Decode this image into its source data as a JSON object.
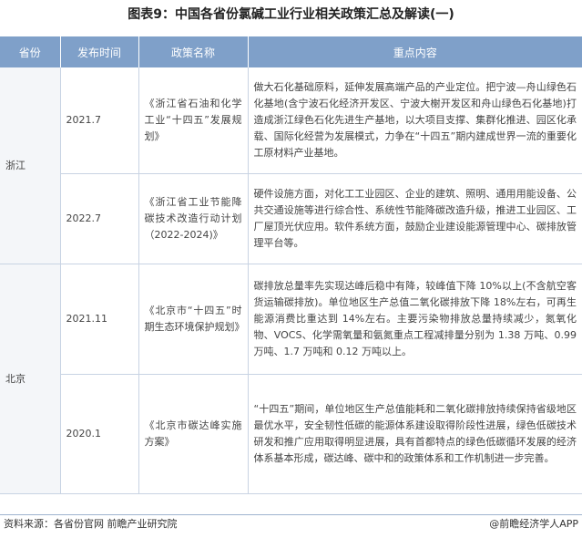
{
  "title": "图表9：中国各省份氯碱工业行业相关政策汇总及解读(一)",
  "headers": [
    "省份",
    "发布时间",
    "政策名称",
    "重点内容"
  ],
  "rows": [
    {
      "province": "浙江",
      "date": "2021.7",
      "name": "《浙江省石油和化学工业“十四五”发展规划》",
      "content": "做大石化基础原料，延伸发展高端产品的产业定位。把宁波—舟山绿色石化基地(含宁波石化经济开发区、宁波大榭开发区和舟山绿色石化基地)打造成浙江绿色石化先进生产基地，以大项目支撑、集群化推进、园区化承载、国际化经营为发展模式，力争在“十四五”期内建成世界一流的重要化工原材料产业基地。"
    },
    {
      "province": "",
      "date": "2022.7",
      "name": "《浙江省工业节能降碳技术改造行动计划（2022-2024)》",
      "content": "硬件设施方面，对化工工业园区、企业的建筑、照明、通用用能设备、公共交通设施等进行综合性、系统性节能降碳改造升级，推进工业园区、工厂屋顶光伏应用。软件系统方面，鼓励企业建设能源管理中心、碳排放管理平台等。"
    },
    {
      "province": "北京",
      "date": "2021.11",
      "name": "《北京市“十四五”时期生态环境保护规划》",
      "content": "碳排放总量率先实现达峰后稳中有降，较峰值下降 10%以上(不含航空客货运输碳排放)。单位地区生产总值二氧化碳排放下降 18%左右，可再生能源消费比重达到 14%左右。主要污染物排放总量持续减少，氮氧化物、VOCS、化学需氧量和氨氮重点工程减排量分别为 1.38 万吨、0.99 万吨、1.7 万吨和 0.12 万吨以上。"
    },
    {
      "province": "",
      "date": "2020.1",
      "name": "《北京市碳达峰实施方案》",
      "content": "“十四五”期间，单位地区生产总值能耗和二氧化碳排放持续保持省级地区最优水平，安全韧性低碳的能源体系建设取得阶段性进展，绿色低碳技术研发和推广应用取得明显进展，具有首都特点的绿色低碳循环发展的经济体系基本形成，碳达峰、碳中和的政策体系和工作机制进一步完善。"
    }
  ],
  "footer": {
    "source": "资料来源：各省份官网 前瞻产业研究院",
    "brand": "@前瞻经济学人APP"
  },
  "colors": {
    "header_bg": "#7fa0c9",
    "border": "#c8d3e3",
    "province_bg": "#f4f6f9"
  }
}
